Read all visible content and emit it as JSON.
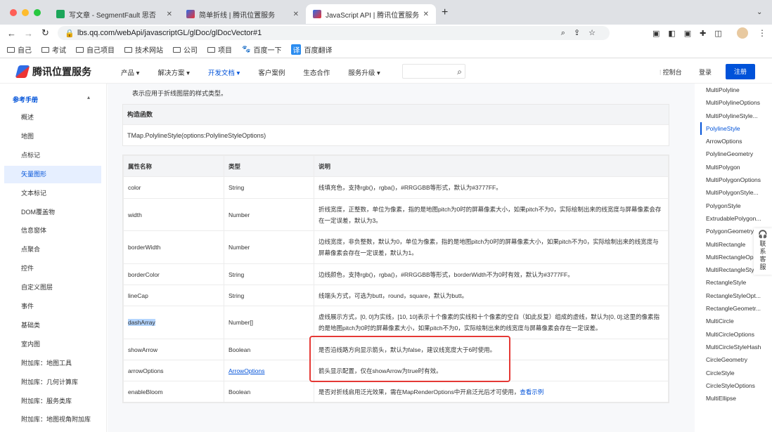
{
  "browser": {
    "tabs": [
      {
        "title": "写文章 - SegmentFault 思否"
      },
      {
        "title": "简单折线 | 腾讯位置服务"
      },
      {
        "title": "JavaScript API | 腾讯位置服务"
      }
    ],
    "url": "lbs.qq.com/webApi/javascriptGL/glDoc/glDocVector#1",
    "bookmarks": [
      "自己",
      "考试",
      "自己项目",
      "技术网站",
      "公司",
      "项目",
      "百度一下",
      "百度翻译"
    ]
  },
  "header": {
    "logo": "腾讯位置服务",
    "nav": [
      "产品",
      "解决方案",
      "开发文档",
      "客户案例",
      "生态合作",
      "服务升级"
    ],
    "console": "控制台",
    "login": "登录",
    "register": "注册"
  },
  "sidebar": {
    "title": "参考手册",
    "items": [
      "概述",
      "地图",
      "点标记",
      "矢量图形",
      "文本标记",
      "DOM覆盖物",
      "信息窗体",
      "点聚合",
      "控件",
      "自定义图层",
      "事件",
      "基础类",
      "室内图",
      "附加库：地图工具",
      "附加库：几何计算库",
      "附加库：服务类库",
      "附加库：地图视角附加库"
    ]
  },
  "content": {
    "intro": "表示应用于折线图层的样式类型。",
    "constructor_title": "构造函数",
    "constructor": "TMap.PolylineStyle(options:PolylineStyleOptions)",
    "headers": [
      "属性名称",
      "类型",
      "说明"
    ],
    "rows": [
      {
        "name": "color",
        "type": "String",
        "desc": "线填充色，支持rgb()，rgba()，#RRGGBB等形式，默认为#3777FF。"
      },
      {
        "name": "width",
        "type": "Number",
        "desc": "折线宽度，正整数，单位为像素，指的是地图pitch为0时的屏幕像素大小，如果pitch不为0，实际绘制出来的线宽度与屏幕像素会存在一定误差，默认为3。"
      },
      {
        "name": "borderWidth",
        "type": "Number",
        "desc": "边线宽度，非负整数，默认为0，单位为像素，指的是地图pitch为0时的屏幕像素大小，如果pitch不为0，实际绘制出来的线宽度与屏幕像素会存在一定误差，默认为1。"
      },
      {
        "name": "borderColor",
        "type": "String",
        "desc": "边线颜色，支持rgb()，rgba()，#RRGGBB等形式，borderWidth不为0时有效，默认为#3777FF。"
      },
      {
        "name": "lineCap",
        "type": "String",
        "desc": "线端头方式，可选为butt，round，square，默认为butt。"
      },
      {
        "name": "dashArray",
        "type": "Number[]",
        "desc": "虚线展示方式，[0, 0]为实线，[10, 10]表示十个像素的实线和十个像素的空白（如此反复）组成的虚线，默认为[0, 0];这里的像素指的是地图pitch为0时的屏幕像素大小，如果pitch不为0，实际绘制出来的线宽度与屏幕像素会存在一定误差。"
      },
      {
        "name": "showArrow",
        "type": "Boolean",
        "desc": "是否沿线路方向显示箭头，默认为false，建议线宽度大于6时使用。"
      },
      {
        "name": "arrowOptions",
        "type": "ArrowOptions",
        "desc": "箭头显示配置，仅在showArrow为true时有效。"
      },
      {
        "name": "enableBloom",
        "type": "Boolean",
        "desc": "是否对折线启用泛光效果，需在MapRenderOptions中开启泛光后才可使用，",
        "link": "查看示例"
      }
    ]
  },
  "right_nav": [
    "MultiPolyline",
    "MultiPolylineOptions",
    "MultiPolylineStyle...",
    "PolylineStyle",
    "ArrowOptions",
    "PolylineGeometry",
    "MultiPolygon",
    "MultiPolygonOptions",
    "MultiPolygonStyle...",
    "PolygonStyle",
    "ExtrudablePolygon...",
    "PolygonGeometry",
    "MultiRectangle",
    "MultiRectangleOp",
    "MultiRectangleSty",
    "RectangleStyle",
    "RectangleStyleOpt...",
    "RectangleGeometr...",
    "MultiCircle",
    "MultiCircleOptions",
    "MultiCircleStyleHash",
    "CircleGeometry",
    "CircleStyle",
    "CircleStyleOptions",
    "MultiEllipse"
  ],
  "contact": "联系客服",
  "colors": {
    "accent": "#0052d9",
    "highlight": "#e53935"
  }
}
